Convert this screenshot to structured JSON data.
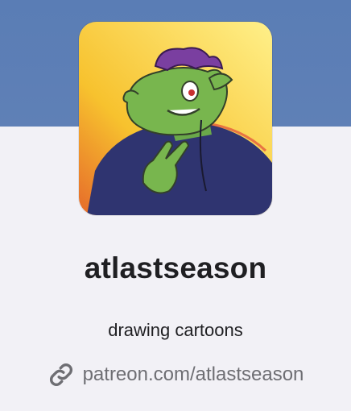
{
  "profile": {
    "username": "atlastseason",
    "bio": "drawing cartoons",
    "link_text": "patreon.com/atlastseason",
    "link_icon": "link-icon",
    "avatar_icon": "cartoon-dinosaur-avatar"
  },
  "colors": {
    "banner": "#5a7db5",
    "background": "#f2f1f6",
    "username": "#1f1f22",
    "link": "#6e6e73"
  }
}
